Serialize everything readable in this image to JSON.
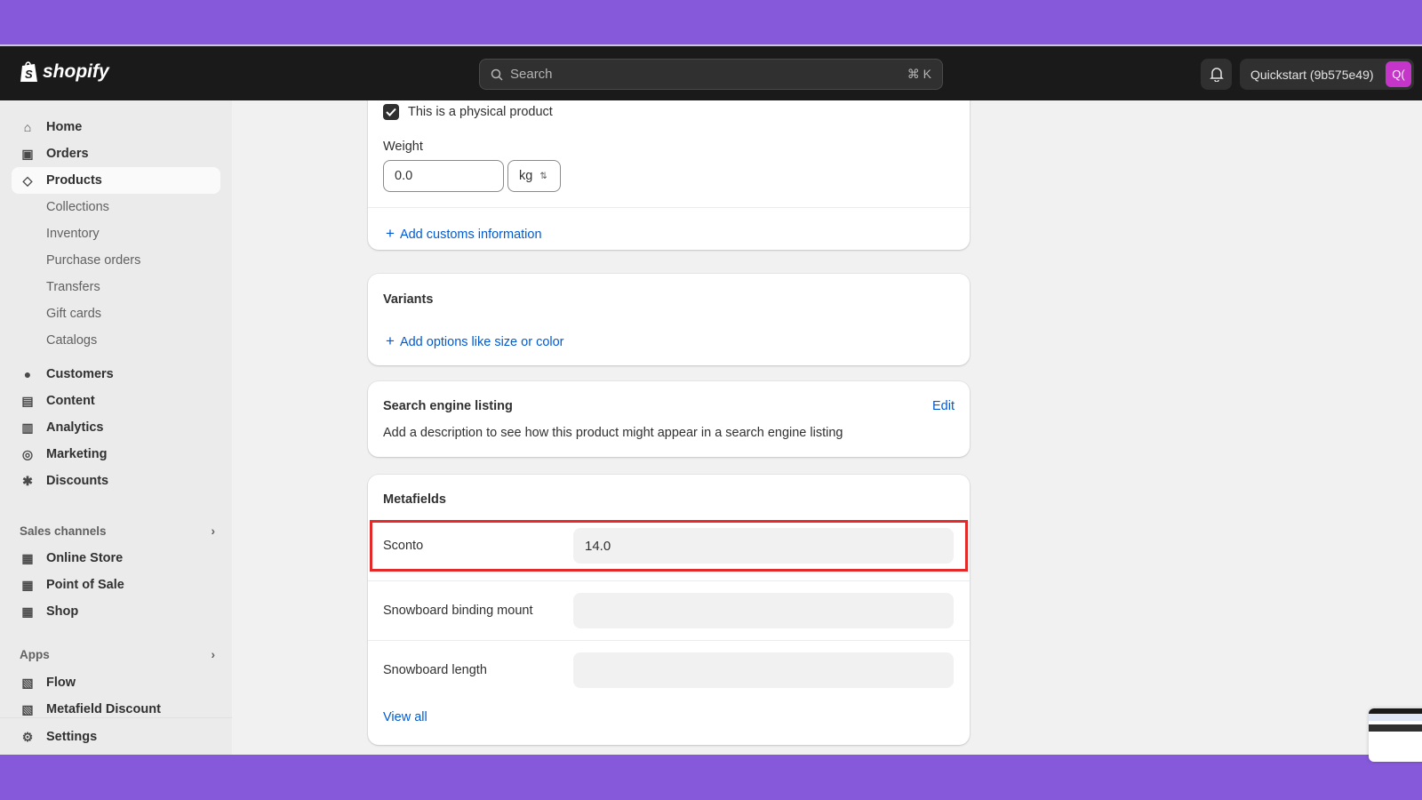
{
  "header": {
    "brand": "shopify",
    "search_placeholder": "Search",
    "search_shortcut": "⌘ K",
    "store_name": "Quickstart (9b575e49)",
    "avatar_initials": "Q("
  },
  "sidebar": {
    "items": [
      {
        "label": "Home",
        "icon": "home-icon"
      },
      {
        "label": "Orders",
        "icon": "inbox-icon"
      },
      {
        "label": "Products",
        "icon": "tag-icon",
        "active": true
      },
      {
        "label": "Collections",
        "sub": true
      },
      {
        "label": "Inventory",
        "sub": true
      },
      {
        "label": "Purchase orders",
        "sub": true
      },
      {
        "label": "Transfers",
        "sub": true
      },
      {
        "label": "Gift cards",
        "sub": true
      },
      {
        "label": "Catalogs",
        "sub": true
      },
      {
        "label": "Customers",
        "icon": "person-icon"
      },
      {
        "label": "Content",
        "icon": "content-icon"
      },
      {
        "label": "Analytics",
        "icon": "bar-chart-icon"
      },
      {
        "label": "Marketing",
        "icon": "target-icon"
      },
      {
        "label": "Discounts",
        "icon": "discount-icon"
      }
    ],
    "sales_channels_label": "Sales channels",
    "channels": [
      {
        "label": "Online Store"
      },
      {
        "label": "Point of Sale"
      },
      {
        "label": "Shop"
      }
    ],
    "apps_label": "Apps",
    "apps": [
      {
        "label": "Flow"
      },
      {
        "label": "Metafield Discount"
      }
    ],
    "settings_label": "Settings"
  },
  "shipping": {
    "physical_label": "This is a physical product",
    "physical_checked": true,
    "weight_label": "Weight",
    "weight_value": "0.0",
    "weight_unit": "kg",
    "customs_link": "Add customs information"
  },
  "variants": {
    "title": "Variants",
    "add_link": "Add options like size or color"
  },
  "seo": {
    "title": "Search engine listing",
    "edit": "Edit",
    "description": "Add a description to see how this product might appear in a search engine listing"
  },
  "metafields": {
    "title": "Metafields",
    "rows": [
      {
        "label": "Sconto",
        "value": "14.0",
        "highlighted": true
      },
      {
        "label": "Snowboard binding mount",
        "value": ""
      },
      {
        "label": "Snowboard length",
        "value": ""
      }
    ],
    "view_all": "View all"
  },
  "colors": {
    "accent": "#005bd3",
    "highlight": "#e32929",
    "frame": "#8559d9"
  }
}
